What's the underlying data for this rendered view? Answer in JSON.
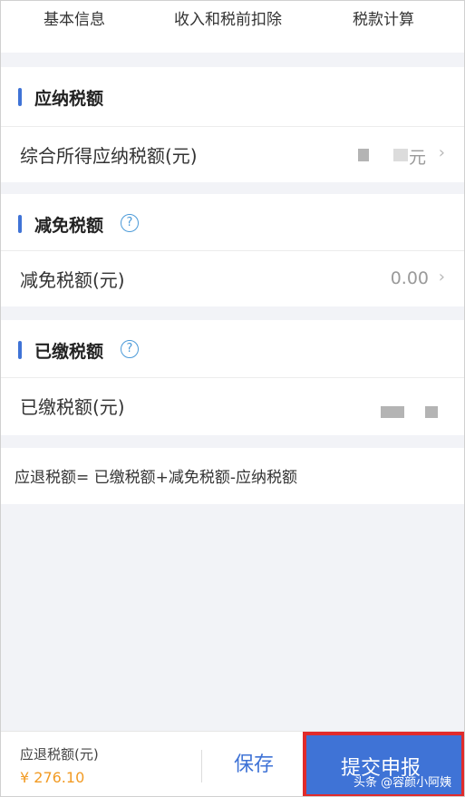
{
  "tabs": [
    {
      "label": "基本信息"
    },
    {
      "label": "收入和税前扣除"
    },
    {
      "label": "税款计算"
    }
  ],
  "sections": {
    "payable": {
      "title": "应纳税额",
      "row_label": "综合所得应纳税额(元)",
      "row_value_suffix": "元"
    },
    "relief": {
      "title": "减免税额",
      "help_symbol": "?",
      "row_label": "减免税额(元)",
      "row_value": "0.00"
    },
    "paid": {
      "title": "已缴税额",
      "help_symbol": "?",
      "row_label": "已缴税额(元)"
    }
  },
  "formula": "应退税额= 已缴税额+减免税额-应纳税额",
  "bottom": {
    "refund_label": "应退税额(元)",
    "refund_amount": "¥ 276.10",
    "save_label": "保存",
    "submit_label": "提交申报"
  },
  "watermark": "头条 @容颜小阿姨",
  "colors": {
    "accent": "#3f73d6",
    "amount": "#f29b24",
    "highlight_border": "#e02b2b"
  },
  "icons": {
    "help": "question-circle-icon",
    "chevron": "chevron-right-icon"
  }
}
